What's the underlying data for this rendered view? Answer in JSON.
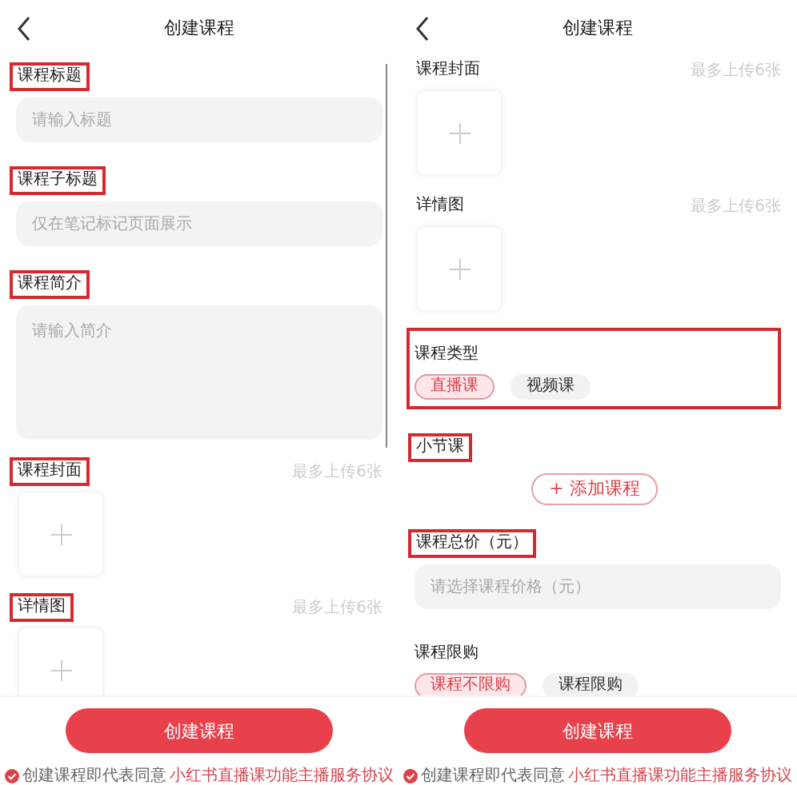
{
  "screens": [
    {
      "title": "创建课程",
      "scrollbar": true,
      "sections": [
        {
          "kind": "input",
          "label": "课程标题",
          "highlighted": true,
          "placeholder": "请输入标题"
        },
        {
          "kind": "input",
          "label": "课程子标题",
          "highlighted": true,
          "placeholder": "仅在笔记标记页面展示"
        },
        {
          "kind": "textarea",
          "label": "课程简介",
          "highlighted": true,
          "placeholder": "请输入简介"
        },
        {
          "kind": "upload",
          "label": "课程封面",
          "highlighted": true,
          "hint": "最多上传6张"
        },
        {
          "kind": "upload",
          "label": "详情图",
          "highlighted": true,
          "hint": "最多上传6张"
        }
      ],
      "button": "创建课程",
      "agreement": {
        "checked": true,
        "text": "创建课程即代表同意",
        "link": "小红书直播课功能主播服务协议"
      }
    },
    {
      "title": "创建课程",
      "sections": [
        {
          "kind": "upload",
          "label": "课程封面",
          "highlighted": false,
          "hint": "最多上传6张"
        },
        {
          "kind": "upload",
          "label": "详情图",
          "highlighted": false,
          "hint": "最多上传6张"
        },
        {
          "kind": "choice",
          "label": "课程类型",
          "highlighted": true,
          "options": [
            {
              "label": "直播课",
              "selected": true
            },
            {
              "label": "视频课",
              "selected": false
            }
          ]
        },
        {
          "kind": "add",
          "label": "小节课",
          "highlighted": true,
          "action": "+ 添加课程"
        },
        {
          "kind": "input",
          "label": "课程总价（元）",
          "highlighted": true,
          "placeholder": "请选择课程价格（元）"
        },
        {
          "kind": "choice",
          "label": "课程限购",
          "highlighted": false,
          "options": [
            {
              "label": "课程不限购",
              "selected": true
            },
            {
              "label": "课程限购",
              "selected": false
            }
          ]
        }
      ],
      "button": "创建课程",
      "agreement": {
        "checked": true,
        "text": "创建课程即代表同意",
        "link": "小红书直播课功能主播服务协议"
      }
    }
  ]
}
